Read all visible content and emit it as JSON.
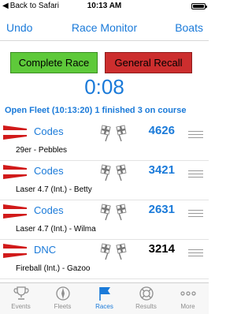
{
  "status_bar": {
    "back_label": "Back to Safari",
    "time": "10:13 AM"
  },
  "nav": {
    "left": "Undo",
    "title": "Race Monitor",
    "right": "Boats"
  },
  "actions": {
    "complete": "Complete Race",
    "recall": "General Recall"
  },
  "timer": "0:08",
  "fleet_info": "Open Fleet (10:13:20) 1 finished 3 on course",
  "rows": [
    {
      "flag": "Codes",
      "sail": "4626",
      "boat": "29er - Pebbles"
    },
    {
      "flag": "Codes",
      "sail": "3421",
      "boat": "Laser 4.7 (Int.) - Betty"
    },
    {
      "flag": "Codes",
      "sail": "2631",
      "boat": "Laser 4.7 (Int.) - Wilma"
    },
    {
      "flag": "DNC",
      "sail": "3214",
      "boat": "Fireball (Int.) - Gazoo"
    }
  ],
  "tabs": [
    {
      "label": "Events",
      "icon": "trophy-icon"
    },
    {
      "label": "Fleets",
      "icon": "compass-icon"
    },
    {
      "label": "Races",
      "icon": "flag-icon"
    },
    {
      "label": "Results",
      "icon": "lifebuoy-icon"
    },
    {
      "label": "More",
      "icon": "more-icon"
    }
  ],
  "colors": {
    "accent": "#1a7ad9",
    "complete_button": "#5ec93a",
    "recall_button": "#cc2e2e",
    "flag_red": "#d11a1a"
  }
}
